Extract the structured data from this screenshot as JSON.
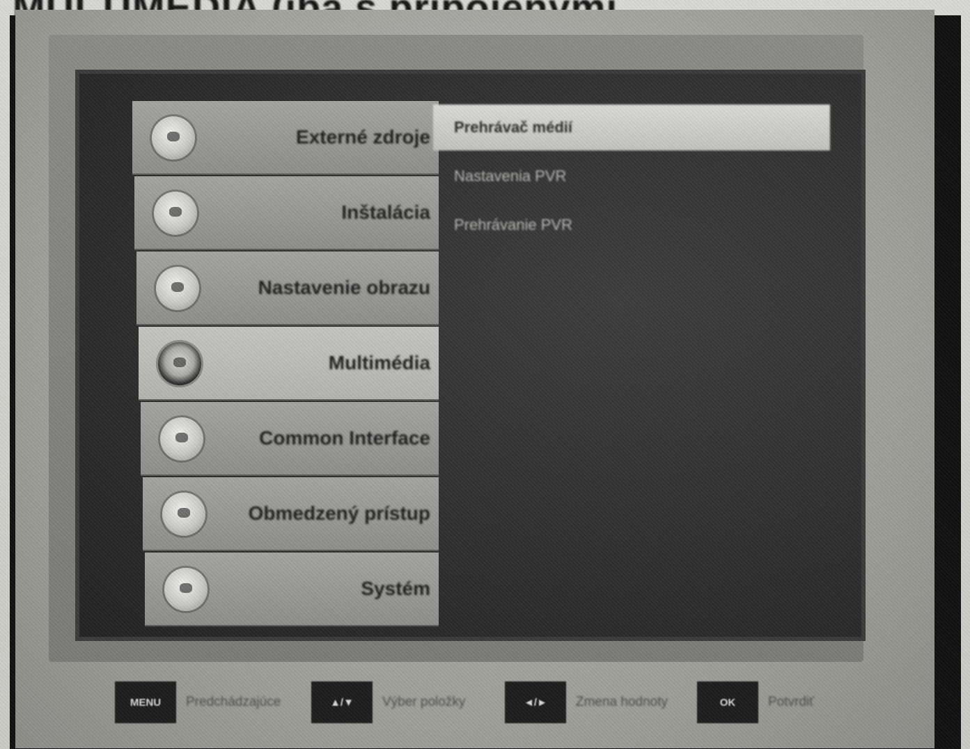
{
  "heading": "MULTIMEDIA (iba s pripojenými...",
  "menu": {
    "items": [
      {
        "label": "Externé zdroje",
        "icon": "source-icon"
      },
      {
        "label": "Inštalácia",
        "icon": "installation-icon"
      },
      {
        "label": "Nastavenie obrazu",
        "icon": "picture-settings-icon"
      },
      {
        "label": "Multimédia",
        "icon": "multimedia-icon",
        "selected": true
      },
      {
        "label": "Common Interface",
        "icon": "common-interface-icon"
      },
      {
        "label": "Obmedzený prístup",
        "icon": "parental-lock-icon"
      },
      {
        "label": "Systém",
        "icon": "system-icon"
      }
    ]
  },
  "submenu": {
    "items": [
      {
        "label": "Prehrávač médií",
        "selected": true
      },
      {
        "label": "Nastavenia PVR"
      },
      {
        "label": "Prehrávanie PVR"
      }
    ]
  },
  "footer": {
    "hints": [
      {
        "key": "MENU",
        "label": "Predchádzajúce"
      },
      {
        "key": "▲/▼",
        "label": "Výber položky"
      },
      {
        "key": "◄/►",
        "label": "Zmena hodnoty"
      },
      {
        "key": "OK",
        "label": "Potvrdiť"
      }
    ]
  },
  "colors": {
    "screen_background": "#2d2d2d",
    "menu_item": "#8e8e8b",
    "menu_item_selected": "#c4c4c1",
    "submenu_selected": "#d9d9d6"
  }
}
